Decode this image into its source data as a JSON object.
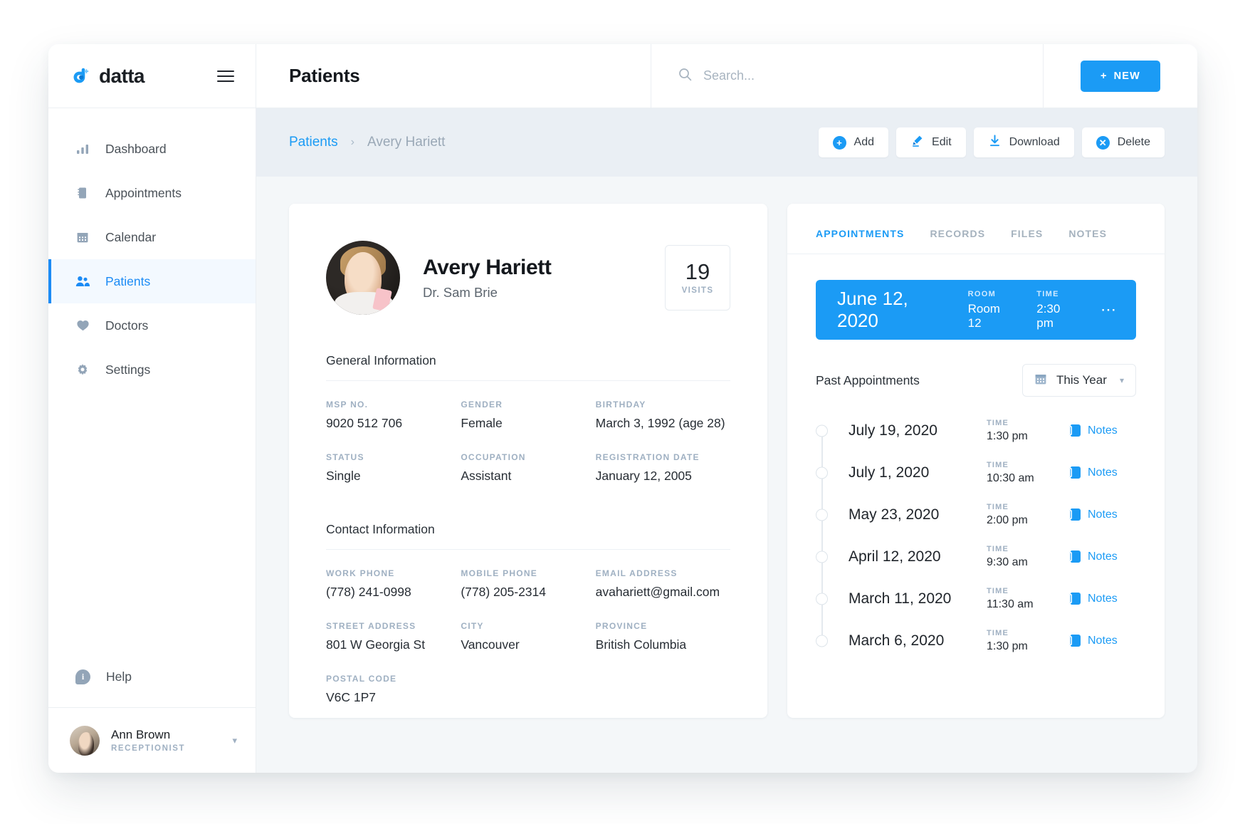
{
  "app": {
    "logo_text": "datta"
  },
  "sidebar": {
    "items": [
      {
        "label": "Dashboard",
        "icon": "bar-chart-icon",
        "active": false
      },
      {
        "label": "Appointments",
        "icon": "notebook-icon",
        "active": false
      },
      {
        "label": "Calendar",
        "icon": "calendar-icon",
        "active": false
      },
      {
        "label": "Patients",
        "icon": "people-icon",
        "active": true
      },
      {
        "label": "Doctors",
        "icon": "heart-icon",
        "active": false
      },
      {
        "label": "Settings",
        "icon": "gear-icon",
        "active": false
      }
    ],
    "help_label": "Help",
    "user": {
      "name": "Ann Brown",
      "role": "RECEPTIONIST"
    }
  },
  "header": {
    "title": "Patients",
    "search_placeholder": "Search...",
    "search_value": "",
    "new_button": "NEW"
  },
  "breadcrumb": {
    "root": "Patients",
    "separator": "›",
    "current": "Avery Hariett"
  },
  "toolbar": {
    "add": "Add",
    "edit": "Edit",
    "download": "Download",
    "delete": "Delete"
  },
  "patient": {
    "name": "Avery Hariett",
    "doctor": "Dr. Sam Brie",
    "visits_count": "19",
    "visits_label": "VISITS",
    "general_title": "General Information",
    "general_fields": [
      {
        "label": "MSP NO.",
        "value": "9020 512 706"
      },
      {
        "label": "GENDER",
        "value": "Female"
      },
      {
        "label": "BIRTHDAY",
        "value": "March 3, 1992 (age 28)"
      },
      {
        "label": "STATUS",
        "value": "Single"
      },
      {
        "label": "OCCUPATION",
        "value": "Assistant"
      },
      {
        "label": "REGISTRATION DATE",
        "value": "January 12, 2005"
      }
    ],
    "contact_title": "Contact Information",
    "contact_fields": [
      {
        "label": "WORK PHONE",
        "value": "(778) 241-0998"
      },
      {
        "label": "MOBILE PHONE",
        "value": "(778) 205-2314"
      },
      {
        "label": "EMAIL ADDRESS",
        "value": "avahariett@gmail.com"
      },
      {
        "label": "STREET ADDRESS",
        "value": "801 W Georgia St"
      },
      {
        "label": "CITY",
        "value": "Vancouver"
      },
      {
        "label": "PROVINCE",
        "value": "British Columbia"
      },
      {
        "label": "POSTAL CODE",
        "value": "V6C 1P7"
      }
    ]
  },
  "right_panel": {
    "tabs": [
      {
        "label": "APPOINTMENTS",
        "active": true
      },
      {
        "label": "RECORDS",
        "active": false
      },
      {
        "label": "FILES",
        "active": false
      },
      {
        "label": "NOTES",
        "active": false
      }
    ],
    "upcoming": {
      "date": "June 12, 2020",
      "room_label": "ROOM",
      "room_value": "Room 12",
      "time_label": "TIME",
      "time_value": "2:30 pm",
      "menu_icon": "ellipsis-icon"
    },
    "past_title": "Past Appointments",
    "filter_value": "This Year",
    "time_label": "TIME",
    "notes_label": "Notes",
    "past_appointments": [
      {
        "date": "July 19, 2020",
        "time": "1:30 pm"
      },
      {
        "date": "July 1, 2020",
        "time": "10:30 am"
      },
      {
        "date": "May 23, 2020",
        "time": "2:00 pm"
      },
      {
        "date": "April 12, 2020",
        "time": "9:30 am"
      },
      {
        "date": "March 11, 2020",
        "time": "11:30 am"
      },
      {
        "date": "March 6, 2020",
        "time": "1:30 pm"
      }
    ]
  },
  "colors": {
    "accent": "#1b9bf5",
    "muted": "#9fb0c2",
    "bg": "#f4f7f9",
    "crumbbar": "#eaeff4"
  }
}
